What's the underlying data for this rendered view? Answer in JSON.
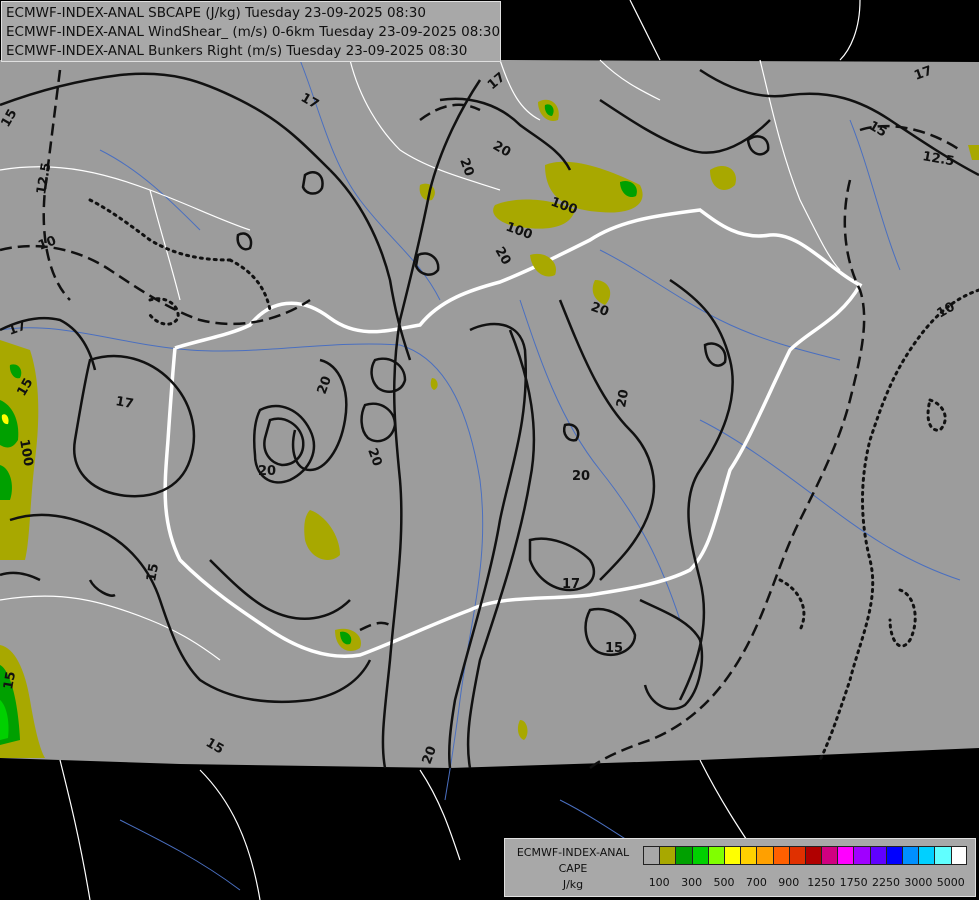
{
  "header": {
    "lines": [
      "ECMWF-INDEX-ANAL SBCAPE (J/kg) Tuesday 23-09-2025 08:30",
      "ECMWF-INDEX-ANAL WindShear_ (m/s) 0-6km Tuesday 23-09-2025 08:30",
      "ECMWF-INDEX-ANAL Bunkers Right (m/s) Tuesday 23-09-2025 08:30"
    ]
  },
  "legend": {
    "title_lines": [
      "ECMWF-INDEX-ANAL",
      "CAPE",
      "J/kg"
    ],
    "colors": [
      "#a8a8a8",
      "#a8a800",
      "#00a000",
      "#00d000",
      "#80ff00",
      "#ffff00",
      "#ffd000",
      "#ffa000",
      "#ff6000",
      "#e03000",
      "#b00000",
      "#d00080",
      "#ff00ff",
      "#a000ff",
      "#6000ff",
      "#0000ff",
      "#0090ff",
      "#00d0ff",
      "#60ffff",
      "#ffffff"
    ],
    "tick_labels": [
      "100",
      "300",
      "500",
      "700",
      "900",
      "1250",
      "1750",
      "2250",
      "3000",
      "5000"
    ]
  },
  "contour_labels": {
    "windshear": [
      "17",
      "15",
      "12.5",
      "10",
      "20",
      "20",
      "17",
      "15",
      "12.5",
      "17",
      "17",
      "17",
      "20",
      "20",
      "20",
      "20",
      "20",
      "20",
      "20",
      "17",
      "15",
      "15",
      "15",
      "20",
      "10"
    ],
    "cape": [
      "100",
      "100",
      "100"
    ]
  }
}
